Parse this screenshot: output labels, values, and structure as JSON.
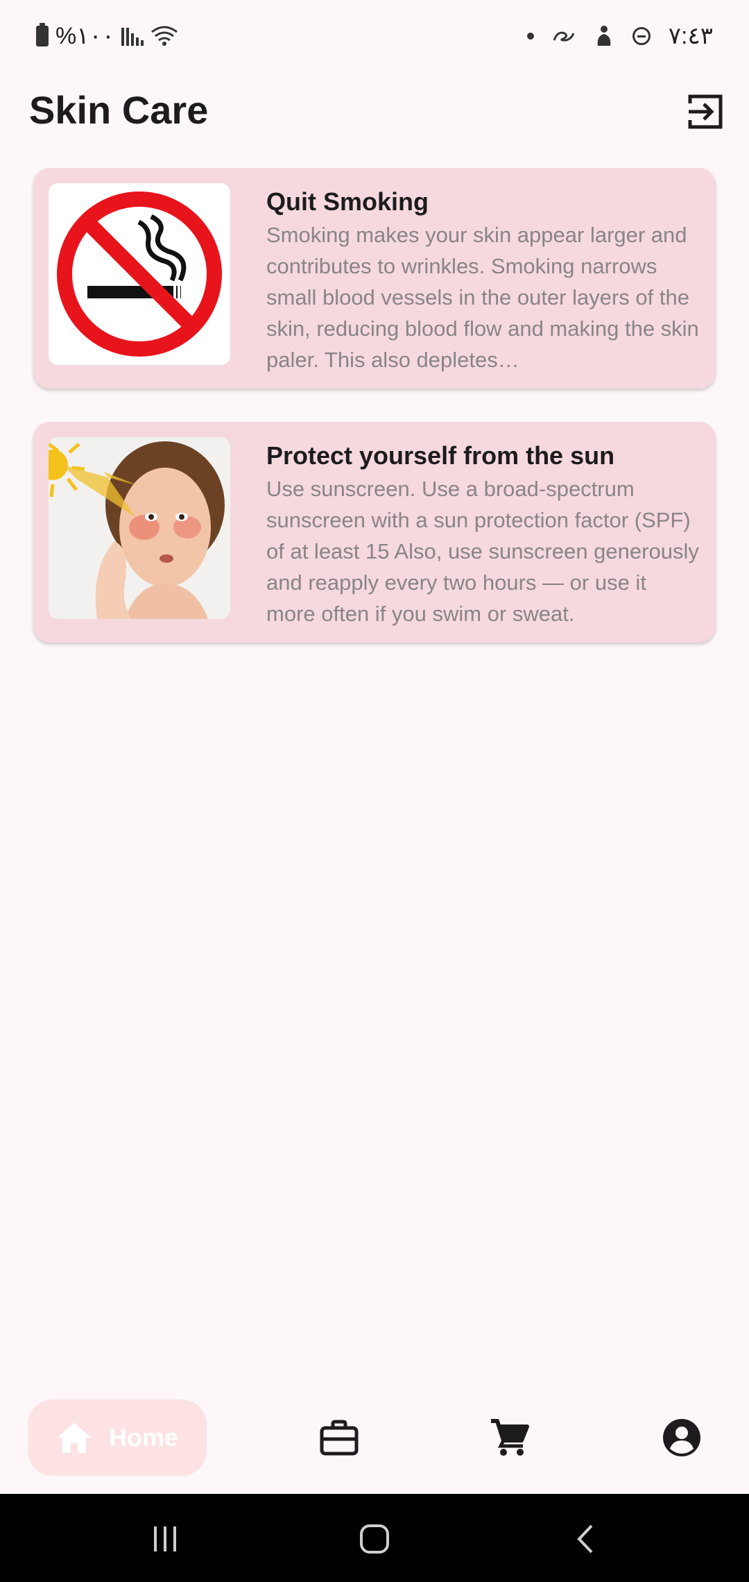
{
  "status_bar": {
    "battery_text": "%١٠٠",
    "time": "٧:٤٣",
    "icons": [
      "battery-icon",
      "signal-icon",
      "wifi-icon",
      "notification-dot-icon",
      "link-icon",
      "meditation-icon",
      "do-not-disturb-icon"
    ]
  },
  "app_bar": {
    "title": "Skin Care",
    "logout_icon": "logout-icon"
  },
  "cards": [
    {
      "title": "Quit Smoking",
      "description": "Smoking makes your skin appear larger and contributes to wrinkles. Smoking narrows small blood vessels in the outer layers of the skin, reducing blood flow and making the skin paler. This also depletes…",
      "image": "no-smoking-sign"
    },
    {
      "title": "Protect yourself from the sun",
      "description": "Use sunscreen. Use a broad-spectrum sunscreen with a  sun protection factor (SPF) of at least 15 Also, use sunscreen generously and reapply every  two hours — or use it more often if you swim or sweat.",
      "image": "sunburned-face"
    }
  ],
  "bottom_nav": {
    "items": [
      {
        "label": "Home",
        "icon": "home-icon",
        "selected": true
      },
      {
        "label": "",
        "icon": "briefcase-icon",
        "selected": false
      },
      {
        "label": "",
        "icon": "cart-icon",
        "selected": false
      },
      {
        "label": "",
        "icon": "account-icon",
        "selected": false
      }
    ]
  },
  "system_nav": {
    "buttons": [
      "recents-button",
      "home-button",
      "back-button"
    ]
  },
  "colors": {
    "background": "#fdf7fa",
    "card": "#f5d9de",
    "nav_selected": "#fde2e4",
    "description_text": "#8a8486"
  }
}
